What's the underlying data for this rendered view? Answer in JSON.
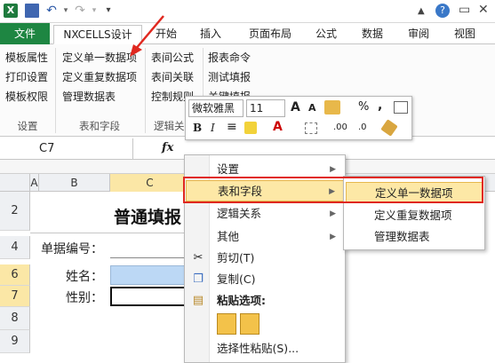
{
  "qat": {
    "logo": "X",
    "undo": "↶",
    "redo": "↷",
    "customize": "▾"
  },
  "window_controls": {
    "minimize": "▲",
    "help": "?",
    "restore": "▭",
    "close": "✕"
  },
  "tabs": [
    {
      "label": "文件",
      "active": false
    },
    {
      "label": "NXCELLS设计",
      "active": true
    },
    {
      "label": "开始",
      "active": false
    },
    {
      "label": "插入",
      "active": false
    },
    {
      "label": "页面布局",
      "active": false
    },
    {
      "label": "公式",
      "active": false
    },
    {
      "label": "数据",
      "active": false
    },
    {
      "label": "审阅",
      "active": false
    },
    {
      "label": "视图",
      "active": false
    }
  ],
  "ribbon": {
    "setup": {
      "items": [
        "模板属性",
        "打印设置",
        "模板权限"
      ],
      "label": "设置"
    },
    "tables": {
      "items": [
        "定义单一数据项",
        "定义重复数据项",
        "管理数据表"
      ],
      "label": "表和字段"
    },
    "logic": {
      "items": [
        "表间公式",
        "表间关联",
        "控制规则"
      ],
      "label": "逻辑关系"
    },
    "report": {
      "items": [
        "报表命令",
        "测试填报",
        "关键填报"
      ]
    }
  },
  "formula_bar": {
    "namebox": "C7",
    "fx": "fx"
  },
  "columns": [
    "A",
    "B",
    "C"
  ],
  "rows": [
    "2",
    "4",
    "6",
    "7",
    "8",
    "9"
  ],
  "sheet": {
    "title": "普通填报",
    "doc_no_label": "单据编号：",
    "name_label": "姓名：",
    "gender_label": "性别："
  },
  "mini_toolbar": {
    "font": "微软雅黑",
    "size": "11",
    "grow": "A",
    "shrink": "A",
    "percent": "%",
    "comma": ",",
    "bold": "B",
    "italic": "I",
    "align": "≡",
    "font_color": "A",
    "dec_inc": ".00",
    "dec_dec": ".0"
  },
  "context_menu": {
    "items": [
      {
        "label": "设置",
        "submenu": true
      },
      {
        "label": "表和字段",
        "submenu": true,
        "highlighted": true
      },
      {
        "label": "逻辑关系",
        "submenu": true
      },
      {
        "label": "其他",
        "submenu": true
      },
      {
        "label": "剪切(T)",
        "submenu": false
      },
      {
        "label": "复制(C)",
        "submenu": false
      },
      {
        "label": "粘贴选项:",
        "submenu": false,
        "bold": true
      },
      {
        "label": "选择性粘贴(S)...",
        "submenu": false
      }
    ]
  },
  "submenu": {
    "items": [
      "定义单一数据项",
      "定义重复数据项",
      "管理数据表"
    ]
  },
  "colors": {
    "file_tab": "#1e8642",
    "highlight": "#fde8a6",
    "annotation": "#e0281f",
    "selection": "#bcd8f5"
  }
}
